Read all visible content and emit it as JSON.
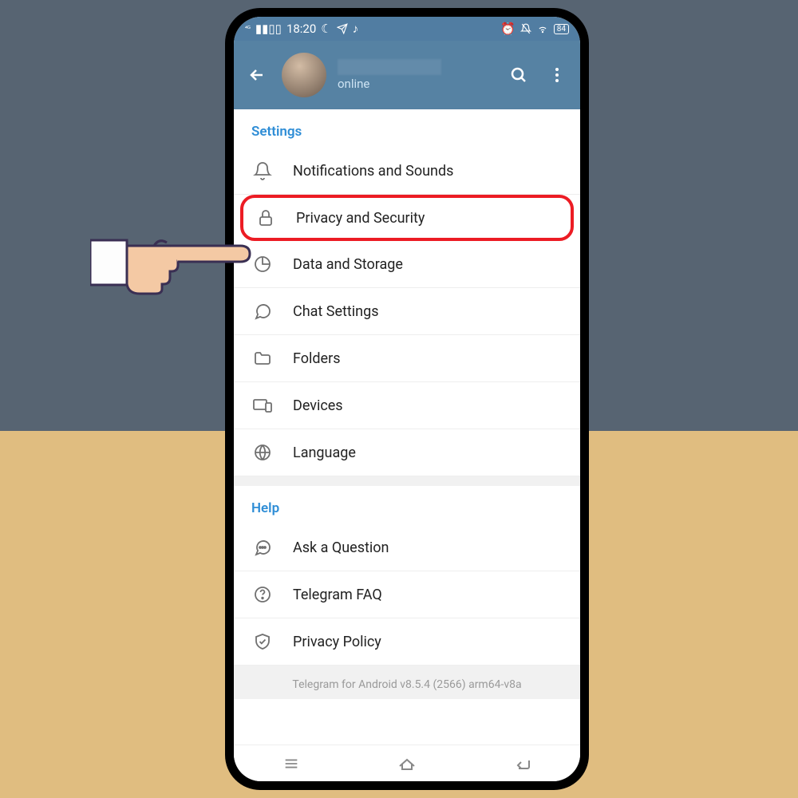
{
  "status_bar": {
    "signal": "4G",
    "time": "18:20",
    "battery": "84"
  },
  "header": {
    "status": "online"
  },
  "sections": {
    "settings": {
      "title": "Settings",
      "items": [
        {
          "label": "Notifications and Sounds"
        },
        {
          "label": "Privacy and Security"
        },
        {
          "label": "Data and Storage"
        },
        {
          "label": "Chat Settings"
        },
        {
          "label": "Folders"
        },
        {
          "label": "Devices"
        },
        {
          "label": "Language"
        }
      ]
    },
    "help": {
      "title": "Help",
      "items": [
        {
          "label": "Ask a Question"
        },
        {
          "label": "Telegram FAQ"
        },
        {
          "label": "Privacy Policy"
        }
      ]
    }
  },
  "footer": "Telegram for Android v8.5.4 (2566) arm64-v8a"
}
